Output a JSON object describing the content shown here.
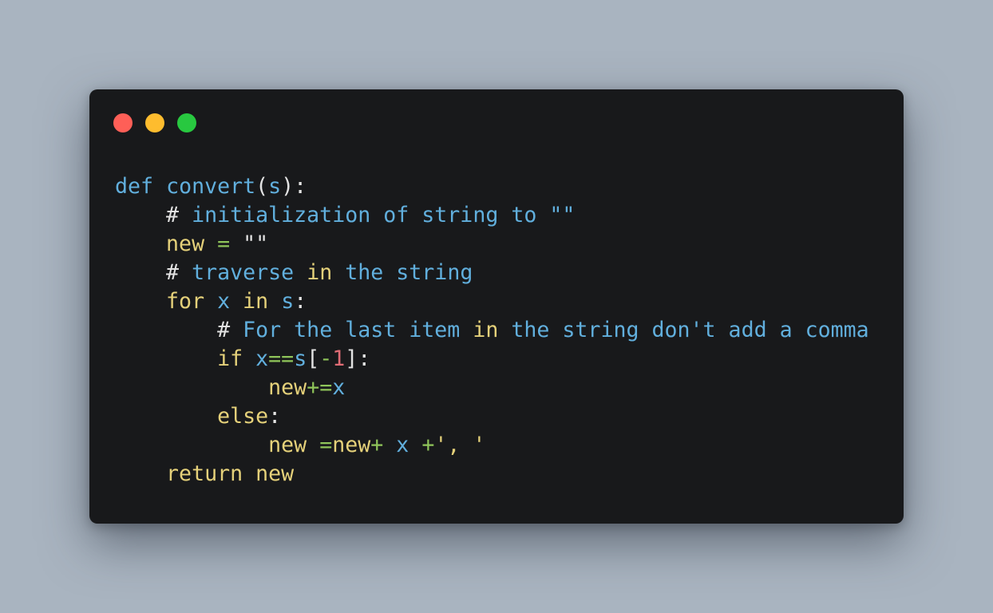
{
  "window": {
    "controls": [
      {
        "name": "close-button",
        "color": "#fe5f57"
      },
      {
        "name": "minimize-button",
        "color": "#febc2e"
      },
      {
        "name": "maximize-button",
        "color": "#28c840"
      }
    ]
  },
  "code": {
    "lines": [
      {
        "indent": 0,
        "tokens": [
          {
            "t": "def",
            "c": "#61afdd"
          },
          {
            "t": " ",
            "c": "#e3e3e3"
          },
          {
            "t": "convert",
            "c": "#61afdd"
          },
          {
            "t": "(",
            "c": "#e3e3e3"
          },
          {
            "t": "s",
            "c": "#61afdd"
          },
          {
            "t": "):",
            "c": "#e3e3e3"
          }
        ]
      },
      {
        "indent": 4,
        "tokens": [
          {
            "t": "# ",
            "c": "#e3e3e3"
          },
          {
            "t": "initialization of string to \"\"",
            "c": "#61afdd"
          }
        ]
      },
      {
        "indent": 4,
        "tokens": [
          {
            "t": "new",
            "c": "#e5d17a"
          },
          {
            "t": " ",
            "c": "#e3e3e3"
          },
          {
            "t": "=",
            "c": "#8fc55a"
          },
          {
            "t": " ",
            "c": "#e3e3e3"
          },
          {
            "t": "\"\"",
            "c": "#e3e3e3"
          }
        ]
      },
      {
        "indent": 4,
        "tokens": [
          {
            "t": "# ",
            "c": "#e3e3e3"
          },
          {
            "t": "traverse ",
            "c": "#61afdd"
          },
          {
            "t": "in",
            "c": "#e5d17a"
          },
          {
            "t": " the string",
            "c": "#61afdd"
          }
        ]
      },
      {
        "indent": 4,
        "tokens": [
          {
            "t": "for",
            "c": "#e5d17a"
          },
          {
            "t": " ",
            "c": "#e3e3e3"
          },
          {
            "t": "x",
            "c": "#61afdd"
          },
          {
            "t": " ",
            "c": "#e3e3e3"
          },
          {
            "t": "in",
            "c": "#e5d17a"
          },
          {
            "t": " ",
            "c": "#e3e3e3"
          },
          {
            "t": "s",
            "c": "#61afdd"
          },
          {
            "t": ":",
            "c": "#e3e3e3"
          }
        ]
      },
      {
        "indent": 8,
        "tokens": [
          {
            "t": "# ",
            "c": "#e3e3e3"
          },
          {
            "t": "For the last item ",
            "c": "#61afdd"
          },
          {
            "t": "in",
            "c": "#e5d17a"
          },
          {
            "t": " the string don't add a comma",
            "c": "#61afdd"
          }
        ]
      },
      {
        "indent": 8,
        "tokens": [
          {
            "t": "if",
            "c": "#e5d17a"
          },
          {
            "t": " ",
            "c": "#e3e3e3"
          },
          {
            "t": "x",
            "c": "#61afdd"
          },
          {
            "t": "==",
            "c": "#8fc55a"
          },
          {
            "t": "s",
            "c": "#61afdd"
          },
          {
            "t": "[",
            "c": "#e3e3e3"
          },
          {
            "t": "-",
            "c": "#8fc55a"
          },
          {
            "t": "1",
            "c": "#e06c75"
          },
          {
            "t": "]:",
            "c": "#e3e3e3"
          }
        ]
      },
      {
        "indent": 12,
        "tokens": [
          {
            "t": "new",
            "c": "#e5d17a"
          },
          {
            "t": "+=",
            "c": "#8fc55a"
          },
          {
            "t": "x",
            "c": "#61afdd"
          }
        ]
      },
      {
        "indent": 8,
        "tokens": [
          {
            "t": "else",
            "c": "#e5d17a"
          },
          {
            "t": ":",
            "c": "#e3e3e3"
          }
        ]
      },
      {
        "indent": 12,
        "tokens": [
          {
            "t": "new",
            "c": "#e5d17a"
          },
          {
            "t": " ",
            "c": "#e3e3e3"
          },
          {
            "t": "=",
            "c": "#8fc55a"
          },
          {
            "t": "new",
            "c": "#e5d17a"
          },
          {
            "t": "+",
            "c": "#8fc55a"
          },
          {
            "t": " ",
            "c": "#e3e3e3"
          },
          {
            "t": "x",
            "c": "#61afdd"
          },
          {
            "t": " ",
            "c": "#e3e3e3"
          },
          {
            "t": "+",
            "c": "#8fc55a"
          },
          {
            "t": "', '",
            "c": "#e5d17a"
          }
        ]
      },
      {
        "indent": 4,
        "tokens": [
          {
            "t": "return",
            "c": "#e5d17a"
          },
          {
            "t": " ",
            "c": "#e3e3e3"
          },
          {
            "t": "new",
            "c": "#e5d17a"
          }
        ]
      }
    ]
  }
}
